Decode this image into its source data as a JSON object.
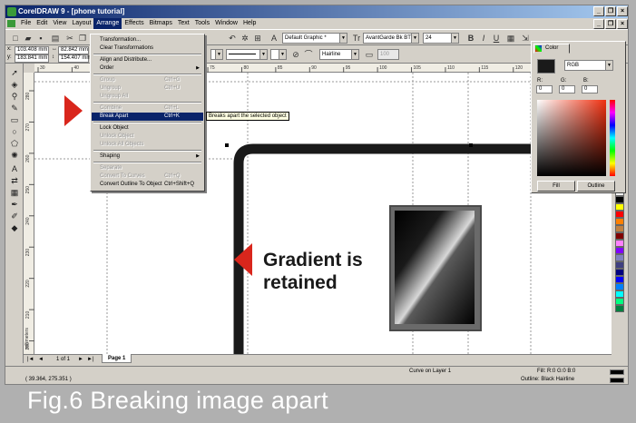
{
  "window": {
    "title": "CorelDRAW 9 - [phone tutorial]",
    "controls": [
      "_",
      "❐",
      "×"
    ]
  },
  "menubar": {
    "items": [
      "File",
      "Edit",
      "View",
      "Layout",
      "Arrange",
      "Effects",
      "Bitmaps",
      "Text",
      "Tools",
      "Window",
      "Help"
    ]
  },
  "toolbar": {
    "graphic_style": "Default Graphic *",
    "font_name": "AvantGarde Bk BT",
    "font_size": "24",
    "bold": "B",
    "italic": "I",
    "underline": "U",
    "zoom_x": "103.408 mm",
    "zoom_y": "183.841 mm",
    "width": "82.842 mm",
    "height": "154.407 mm",
    "outline_width": "Hairline",
    "percent": "100"
  },
  "arrange_menu": {
    "items": [
      {
        "label": "Transformation...",
        "shortcut": "",
        "state": "normal",
        "submenu": false
      },
      {
        "label": "Clear Transformations",
        "shortcut": "",
        "state": "normal",
        "submenu": false
      },
      {
        "sep": true
      },
      {
        "label": "Align and Distribute...",
        "shortcut": "",
        "state": "normal",
        "submenu": false
      },
      {
        "label": "Order",
        "shortcut": "",
        "state": "normal",
        "submenu": true
      },
      {
        "sep": true
      },
      {
        "label": "Group",
        "shortcut": "Ctrl+G",
        "state": "disabled",
        "submenu": false
      },
      {
        "label": "Ungroup",
        "shortcut": "Ctrl+U",
        "state": "disabled",
        "submenu": false
      },
      {
        "label": "Ungroup All",
        "shortcut": "",
        "state": "disabled",
        "submenu": false
      },
      {
        "sep": true
      },
      {
        "label": "Combine",
        "shortcut": "Ctrl+L",
        "state": "disabled",
        "submenu": false
      },
      {
        "label": "Break Apart",
        "shortcut": "Ctrl+K",
        "state": "selected",
        "submenu": false
      },
      {
        "sep": true
      },
      {
        "label": "Lock Object",
        "shortcut": "",
        "state": "normal",
        "submenu": false
      },
      {
        "label": "Unlock Object",
        "shortcut": "",
        "state": "disabled",
        "submenu": false
      },
      {
        "label": "Unlock All Objects",
        "shortcut": "",
        "state": "disabled",
        "submenu": false
      },
      {
        "sep": true
      },
      {
        "label": "Shaping",
        "shortcut": "",
        "state": "normal",
        "submenu": true
      },
      {
        "sep": true
      },
      {
        "label": "Separate",
        "shortcut": "",
        "state": "disabled",
        "submenu": false
      },
      {
        "label": "Convert To Curves",
        "shortcut": "Ctrl+Q",
        "state": "disabled",
        "submenu": false
      },
      {
        "label": "Convert Outline To Object",
        "shortcut": "Ctrl+Shift+Q",
        "state": "normal",
        "submenu": false
      }
    ]
  },
  "tooltip": "Breaks apart the selected object",
  "ruler": {
    "h_ticks": [
      "30",
      "40",
      "50",
      "60",
      "70",
      "75",
      "80",
      "85",
      "90",
      "95",
      "100",
      "105",
      "110",
      "115",
      "120",
      "125",
      "130"
    ],
    "v_ticks": [
      "280",
      "270",
      "260",
      "250",
      "240",
      "230",
      "220",
      "210",
      "200"
    ],
    "units": "millimeters"
  },
  "annotation": {
    "line1": "Gradient is",
    "line2": "retained"
  },
  "color_docker": {
    "tab": "Color",
    "model": "RGB",
    "labels": [
      "R:",
      "G:",
      "B:"
    ],
    "values": [
      "0",
      "0",
      "0"
    ],
    "fill_button": "Fill",
    "outline_button": "Outline"
  },
  "pages": {
    "nav_first": "|◄",
    "nav_prev": "◄",
    "position": "1 of 1",
    "nav_next": "►",
    "nav_last": "►|",
    "tab": "Page 1"
  },
  "status": {
    "coords": "( 39.364, 275.351 )",
    "object": "Curve on Layer 1",
    "fill": "Fill: R:0 G:0 B:0",
    "outline": "Outline: Black  Hairline"
  },
  "caption": "Fig.6  Breaking image apart",
  "palette_colors": [
    "#ffffff",
    "#000000",
    "#ffff00",
    "#ff0000",
    "#ff8000",
    "#c08040",
    "#800000",
    "#ff80ff",
    "#8000ff",
    "#8080c0",
    "#404080",
    "#000080",
    "#0000ff",
    "#0080ff",
    "#00ffff",
    "#00ff80",
    "#008040"
  ]
}
